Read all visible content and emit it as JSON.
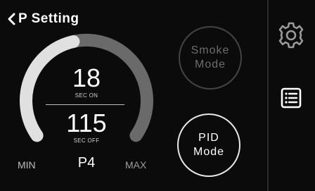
{
  "header": {
    "title": "P Setting"
  },
  "gauge": {
    "on_value": "18",
    "on_label": "SEC ON",
    "off_value": "115",
    "off_label": "SEC OFF",
    "level": "P4",
    "min_label": "MIN",
    "max_label": "MAX",
    "level_fraction": 0.45
  },
  "modes": {
    "smoke": [
      "Smoke",
      "Mode"
    ],
    "pid": [
      "PID",
      "Mode"
    ]
  },
  "sidebar": {
    "icons": [
      "gear-icon",
      "list-icon"
    ]
  },
  "colors": {
    "background": "#0b0b0b",
    "arc_active": "#e0e0e0",
    "arc_inactive": "#6a6a6a",
    "inactive_text": "#6d6d6d"
  }
}
